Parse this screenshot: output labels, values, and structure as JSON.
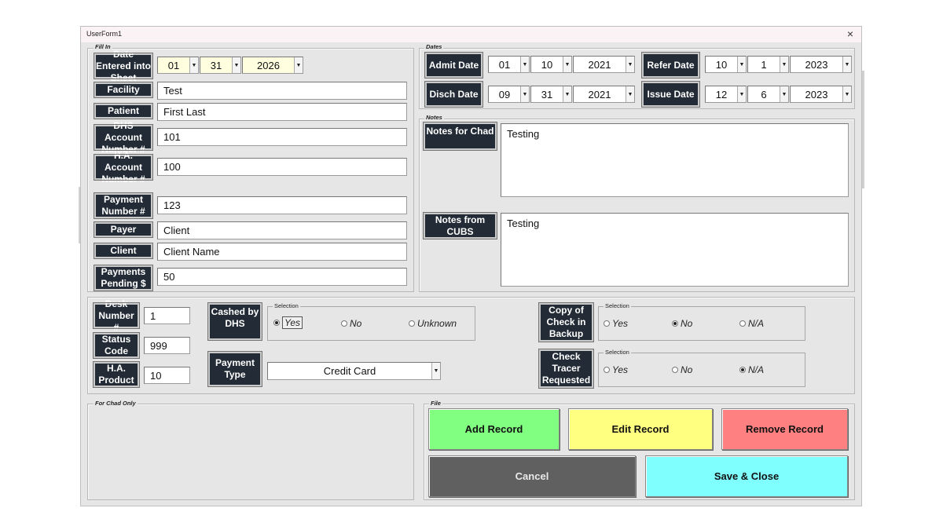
{
  "window": {
    "title": "UserForm1",
    "close_glyph": "×"
  },
  "frames": {
    "fill_in": "Fill In",
    "dates": "Dates",
    "notes": "Notes",
    "for_chad": "For Chad Only",
    "file": "File"
  },
  "fill_in": {
    "date_entered": {
      "label": "Date Entered into Sheet",
      "month": "01",
      "day": "31",
      "year": "2026"
    },
    "facility": {
      "label": "Facility",
      "value": "Test"
    },
    "patient": {
      "label": "Patient",
      "value": "First Last"
    },
    "dhs_account": {
      "label": "DHS Account Number #",
      "value": "101"
    },
    "ha_account": {
      "label": "H.A. Account Number #",
      "value": "100"
    },
    "payment_number": {
      "label": "Payment Number #",
      "value": "123"
    },
    "payer": {
      "label": "Payer",
      "value": "Client"
    },
    "client": {
      "label": "Client",
      "value": "Client Name"
    },
    "payments_pending": {
      "label": "Payments Pending $",
      "value": "50"
    }
  },
  "dates": {
    "admit": {
      "label": "Admit Date",
      "month": "01",
      "day": "10",
      "year": "2021"
    },
    "disch": {
      "label": "Disch Date",
      "month": "09",
      "day": "31",
      "year": "2021"
    },
    "refer": {
      "label": "Refer Date",
      "month": "10",
      "day": "1",
      "year": "2023"
    },
    "issue": {
      "label": "Issue Date",
      "month": "12",
      "day": "6",
      "year": "2023"
    }
  },
  "notes": {
    "for_chad": {
      "label": "Notes for Chad",
      "value": "Testing"
    },
    "from_cubs": {
      "label": "Notes from CUBS",
      "value": "Testing"
    }
  },
  "middle": {
    "desk_number": {
      "label": "Desk Number #",
      "value": "1"
    },
    "status_code": {
      "label": "Status Code",
      "value": "999"
    },
    "ha_product": {
      "label": "H.A. Product",
      "value": "10"
    },
    "cashed_by_dhs": {
      "label": "Cashed by DHS",
      "caption": "Selection",
      "options": [
        "Yes",
        "No",
        "Unknown"
      ],
      "selected": "Yes"
    },
    "payment_type": {
      "label": "Payment Type",
      "value": "Credit Card"
    },
    "copy_of_check": {
      "label": "Copy of Check in Backup",
      "caption": "Selection",
      "options": [
        "Yes",
        "No",
        "N/A"
      ],
      "selected": "No"
    },
    "check_tracer": {
      "label": "Check Tracer Requested",
      "caption": "Selection",
      "options": [
        "Yes",
        "No",
        "N/A"
      ],
      "selected": "N/A"
    }
  },
  "buttons": {
    "add": {
      "label": "Add Record",
      "color": "#80ff80"
    },
    "edit": {
      "label": "Edit Record",
      "color": "#ffff80"
    },
    "remove": {
      "label": "Remove Record",
      "color": "#ff8080"
    },
    "cancel": {
      "label": "Cancel",
      "color": "#606060"
    },
    "save": {
      "label": "Save & Close",
      "color": "#80ffff"
    }
  },
  "icons": {
    "dropdown": "dropdown-arrow-icon",
    "close": "close-icon",
    "radio": "radio-button-icon"
  }
}
